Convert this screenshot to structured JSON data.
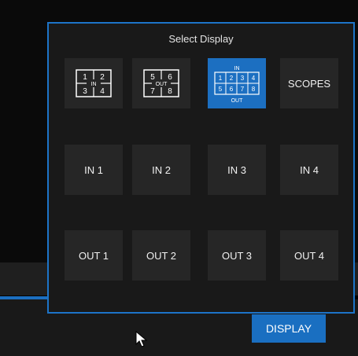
{
  "window": {
    "title": "Select Display"
  },
  "layouts": [
    {
      "name": "input-quad",
      "cells": [
        "1",
        "2",
        "3",
        "4"
      ],
      "center_label": "IN",
      "selected": false
    },
    {
      "name": "output-quad",
      "cells": [
        "5",
        "6",
        "7",
        "8"
      ],
      "center_label": "OUT",
      "selected": false
    },
    {
      "name": "in-out-multiview",
      "top_label": "IN",
      "bottom_label": "OUT",
      "cells": [
        "1",
        "2",
        "3",
        "4",
        "5",
        "6",
        "7",
        "8"
      ],
      "selected": true
    },
    {
      "name": "scopes",
      "label": "SCOPES",
      "selected": false
    }
  ],
  "inputs": [
    "IN 1",
    "IN 2",
    "IN 3",
    "IN 4"
  ],
  "outputs": [
    "OUT 1",
    "OUT 2",
    "OUT 3",
    "OUT 4"
  ],
  "footer": {
    "display_label": "DISPLAY"
  },
  "colors": {
    "accent": "#1c6fc1",
    "tile": "#262626",
    "panel": "#191919"
  }
}
